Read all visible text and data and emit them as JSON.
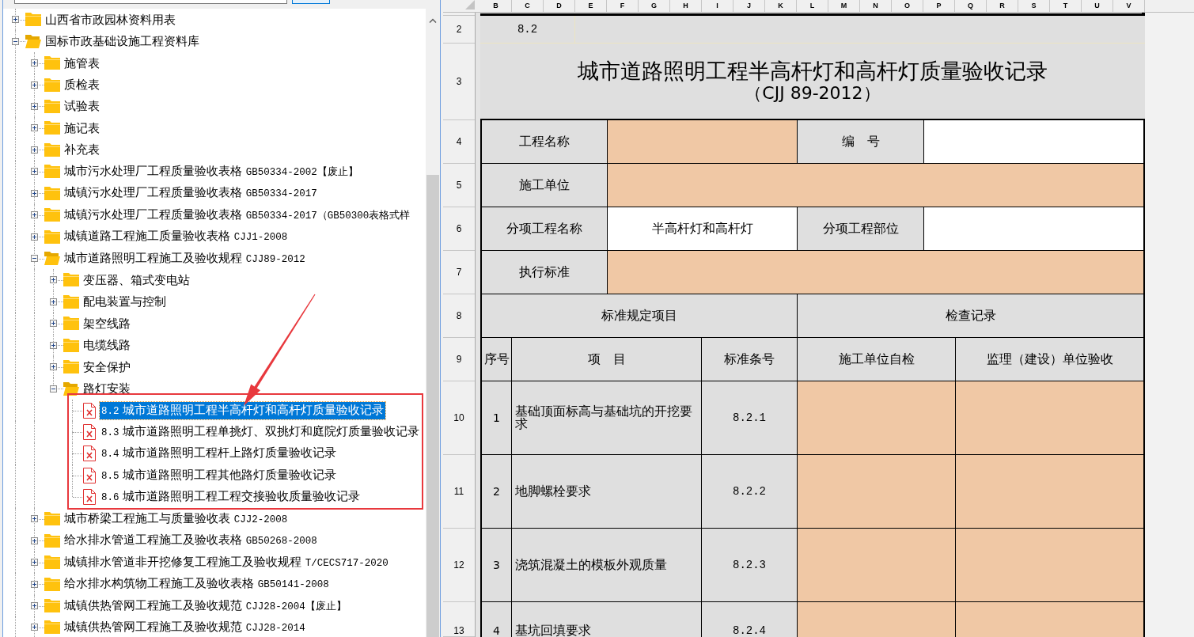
{
  "tree": [
    {
      "kind": "folder",
      "name": "山西省市政园林资料用表",
      "expanded": false,
      "selected": false
    },
    {
      "kind": "folder",
      "name": "国标市政基础设施工程资料库",
      "expanded": true,
      "selected": false,
      "children": [
        {
          "kind": "folder",
          "name": "施管表",
          "expanded": false,
          "selected": false
        },
        {
          "kind": "folder",
          "name": "质检表",
          "expanded": false,
          "selected": false
        },
        {
          "kind": "folder",
          "name": "试验表",
          "expanded": false,
          "selected": false
        },
        {
          "kind": "folder",
          "name": "施记表",
          "expanded": false,
          "selected": false
        },
        {
          "kind": "folder",
          "name": "补充表",
          "expanded": false,
          "selected": false
        },
        {
          "kind": "folder",
          "name": "城市污水处理厂工程质量验收表格",
          "code": "GB50334-2002【废止】",
          "expanded": false,
          "selected": false
        },
        {
          "kind": "folder",
          "name": "城镇污水处理厂工程质量验收表格",
          "code": "GB50334-2017",
          "expanded": false,
          "selected": false
        },
        {
          "kind": "folder",
          "name": "城镇污水处理厂工程质量验收表格",
          "code": "GB50334-2017（GB50300表格式样",
          "expanded": false,
          "selected": false
        },
        {
          "kind": "folder",
          "name": "城镇道路工程施工质量验收表格",
          "code": "CJJ1-2008",
          "expanded": false,
          "selected": false
        },
        {
          "kind": "folder",
          "name": "城市道路照明工程施工及验收规程",
          "code": "CJJ89-2012",
          "expanded": true,
          "selected": false,
          "children": [
            {
              "kind": "folder",
              "name": "变压器、箱式变电站",
              "expanded": false,
              "selected": false
            },
            {
              "kind": "folder",
              "name": "配电装置与控制",
              "expanded": false,
              "selected": false
            },
            {
              "kind": "folder",
              "name": "架空线路",
              "expanded": false,
              "selected": false
            },
            {
              "kind": "folder",
              "name": "电缆线路",
              "expanded": false,
              "selected": false
            },
            {
              "kind": "folder",
              "name": "安全保护",
              "expanded": false,
              "selected": false
            },
            {
              "kind": "folder",
              "name": "路灯安装",
              "expanded": true,
              "selected": false,
              "children": [
                {
                  "kind": "file",
                  "code": "8.2",
                  "name": "城市道路照明工程半高杆灯和高杆灯质量验收记录",
                  "selected": true
                },
                {
                  "kind": "file",
                  "code": "8.3",
                  "name": "城市道路照明工程单挑灯、双挑灯和庭院灯质量验收记录",
                  "selected": false
                },
                {
                  "kind": "file",
                  "code": "8.4",
                  "name": "城市道路照明工程杆上路灯质量验收记录",
                  "selected": false
                },
                {
                  "kind": "file",
                  "code": "8.5",
                  "name": "城市道路照明工程其他路灯质量验收记录",
                  "selected": false
                },
                {
                  "kind": "file",
                  "code": "8.6",
                  "name": "城市道路照明工程工程交接验收质量验收记录",
                  "selected": false
                }
              ]
            }
          ]
        },
        {
          "kind": "folder",
          "name": "城市桥梁工程施工与质量验收表",
          "code": "CJJ2-2008",
          "expanded": false,
          "selected": false
        },
        {
          "kind": "folder",
          "name": "给水排水管道工程施工及验收表格",
          "code": "GB50268-2008",
          "expanded": false,
          "selected": false
        },
        {
          "kind": "folder",
          "name": "城镇排水管道非开挖修复工程施工及验收规程",
          "code": "T/CECS717-2020",
          "expanded": false,
          "selected": false
        },
        {
          "kind": "folder",
          "name": "给水排水构筑物工程施工及验收表格",
          "code": "GB50141-2008",
          "expanded": false,
          "selected": false
        },
        {
          "kind": "folder",
          "name": "城镇供热管网工程施工及验收规范",
          "code": "CJJ28-2004【废止】",
          "expanded": false,
          "selected": false
        },
        {
          "kind": "folder",
          "name": "城镇供热管网工程施工及验收规范",
          "code": "CJJ28-2014",
          "expanded": false,
          "selected": false
        }
      ]
    }
  ],
  "sheet": {
    "column_headers": [
      "B",
      "C",
      "D",
      "E",
      "F",
      "G",
      "H",
      "I",
      "J",
      "K",
      "L",
      "M",
      "N",
      "O",
      "P",
      "Q",
      "R",
      "S",
      "T",
      "U",
      "V"
    ],
    "row_headers": [
      "2",
      "3",
      "4",
      "5",
      "6",
      "7",
      "8",
      "9",
      "10",
      "11",
      "12",
      "13"
    ],
    "code": "8.2",
    "title": "城市道路照明工程半高杆灯和高杆灯质量验收记录",
    "standard": "（CJJ 89-2012）",
    "info_rows": [
      {
        "cells": [
          {
            "kind": "label",
            "text": "工程名称"
          },
          {
            "kind": "field",
            "highlighted": true
          },
          {
            "kind": "label",
            "text": "编　号"
          },
          {
            "kind": "field",
            "highlighted": false
          }
        ]
      },
      {
        "cells": [
          {
            "kind": "label",
            "text": "施工单位"
          },
          {
            "kind": "field",
            "highlighted": true
          }
        ]
      },
      {
        "cells": [
          {
            "kind": "label",
            "text": "分项工程名称"
          },
          {
            "kind": "field",
            "highlighted": false,
            "value": "半高杆灯和高杆灯"
          },
          {
            "kind": "label",
            "text": "分项工程部位"
          },
          {
            "kind": "field",
            "highlighted": false
          }
        ]
      },
      {
        "cells": [
          {
            "kind": "label",
            "text": "执行标准"
          },
          {
            "kind": "field",
            "highlighted": true
          }
        ]
      }
    ],
    "sections": [
      "标准规定项目",
      "检查记录"
    ],
    "columns": [
      "序号",
      "项　目",
      "标准条号",
      "施工单位自检",
      "监理（建设）单位验收"
    ],
    "rows": [
      {
        "no": "1",
        "item": "基础顶面标高与基础坑的开挖要求",
        "clause": "8.2.1",
        "fields": [
          {
            "highlighted": true
          },
          {
            "highlighted": true
          }
        ]
      },
      {
        "no": "2",
        "item": "地脚螺栓要求",
        "clause": "8.2.2",
        "fields": [
          {
            "highlighted": true
          },
          {
            "highlighted": true
          }
        ]
      },
      {
        "no": "3",
        "item": "浇筑混凝土的模板外观质量",
        "clause": "8.2.3",
        "fields": [
          {
            "highlighted": true
          },
          {
            "highlighted": true
          }
        ]
      },
      {
        "no": "4",
        "item": "基坑回填要求",
        "clause": "8.2.4",
        "fields": [
          {
            "highlighted": true
          },
          {
            "highlighted": true
          }
        ]
      }
    ]
  }
}
